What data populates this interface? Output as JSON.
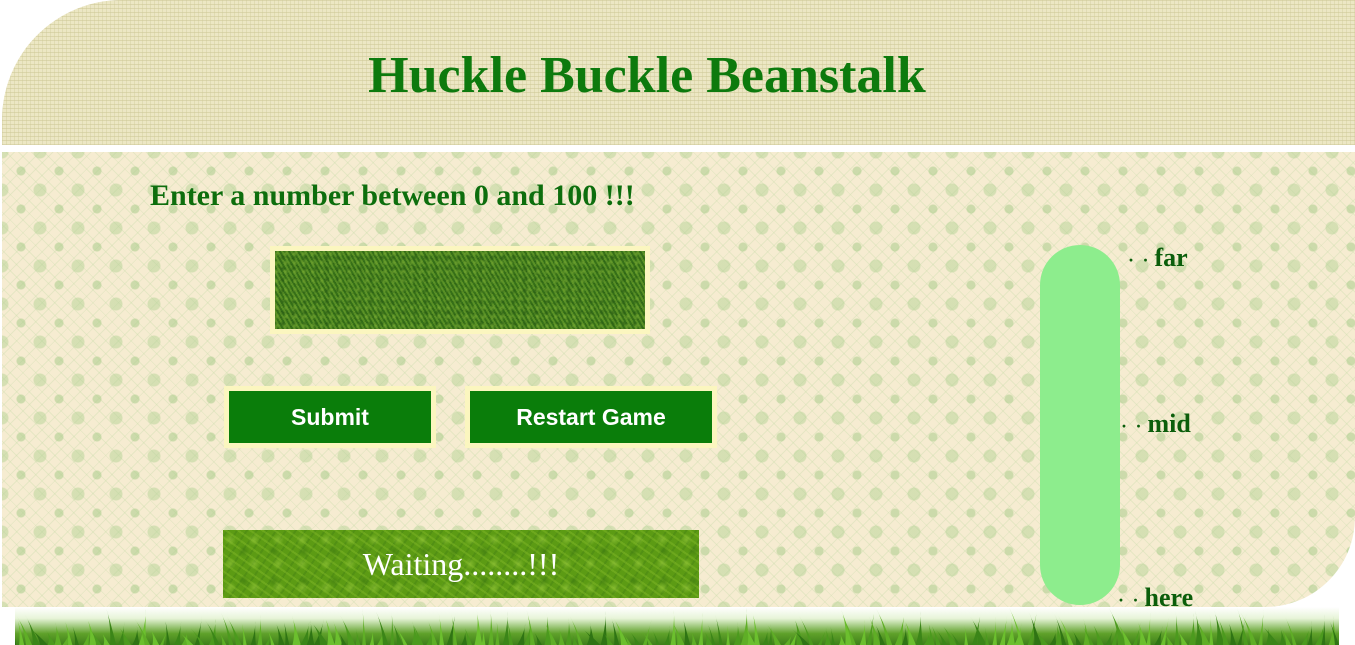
{
  "header": {
    "title": "Huckle Buckle Beanstalk"
  },
  "game": {
    "prompt": "Enter a number between 0 and 100 !!!",
    "input_value": "",
    "input_placeholder": "",
    "submit_label": "Submit",
    "restart_label": "Restart Game",
    "status_text": "Waiting........!!!"
  },
  "meter": {
    "labels": {
      "far": "far",
      "mid": "mid",
      "here": "here"
    },
    "dots": "· ·",
    "level": 0,
    "track_color": "#8ded8d",
    "fill_color": "#2e9a2e"
  },
  "colors": {
    "title_green": "#0d7a0d",
    "button_green": "#0a7d0a",
    "button_border": "#fbf6bf"
  }
}
